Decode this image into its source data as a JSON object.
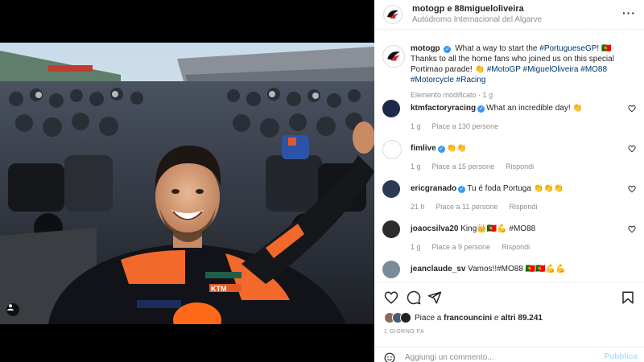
{
  "header": {
    "users": "motogp e 88migueloliveira",
    "location": "Autódromo Internacional del Algarve",
    "more_label": "···"
  },
  "caption": {
    "username": "motogp",
    "text_before_tag": "What a way to start the ",
    "tag_portuguese_gp": "#PortugueseGP!",
    "text_middle": " 🇵🇹 Thanks to all the home fans who joined us on this special Portimao parade! 👏 ",
    "tags_line": "#MotoGP #MiguelOliveira #MO88 #Motorcycle #Racing",
    "meta": "Elemento modificato · 1 g"
  },
  "comments": [
    {
      "username": "ktmfactoryracing",
      "verified": true,
      "text": "What an incredible day! 👏",
      "time": "1 g",
      "likes": "Piace a 130 persone",
      "reply": "",
      "avatar_color": "#1c2a4a"
    },
    {
      "username": "fimlive",
      "verified": true,
      "text": "👏👏",
      "time": "1 g",
      "likes": "Piace a 15 persone",
      "reply": "Rispondi",
      "avatar_color": "#ffffff"
    },
    {
      "username": "ericgranado",
      "verified": true,
      "text": "Tu é foda Portuga 👏👏👏",
      "time": "21 h",
      "likes": "Piace a 11 persone",
      "reply": "Rispondi",
      "avatar_color": "#2b3a55"
    },
    {
      "username": "joaocsilva20",
      "verified": false,
      "text": "King👑🇵🇹💪 #MO88",
      "time": "1 g",
      "likes": "Piace a 9 persone",
      "reply": "Rispondi",
      "avatar_color": "#2c2c2c"
    },
    {
      "username": "jeanclaude_sv",
      "verified": false,
      "text": "Vamos!!#MO88 🇵🇹🇵🇹💪💪",
      "time": "",
      "likes": "",
      "reply": "",
      "avatar_color": "#7a8a9a"
    }
  ],
  "likes": {
    "prefix": "Piace a ",
    "user": "francouncini",
    "suffix": " e ",
    "others": "altri 89.241"
  },
  "post_time": "1 GIORNO FA",
  "comment_box": {
    "placeholder": "Aggiungi un commento...",
    "publish_label": "Pubblica"
  },
  "colors": {
    "accent": "#3897f0",
    "hashtag": "#00376b",
    "muted": "#8e8e8e",
    "publish_disabled": "#b2dffc"
  },
  "icons": [
    "more-options-icon",
    "motogp-logo-icon",
    "heart-icon",
    "comment-icon",
    "share-icon",
    "bookmark-icon",
    "emoji-icon",
    "tag-user-icon",
    "verified-badge-icon"
  ]
}
